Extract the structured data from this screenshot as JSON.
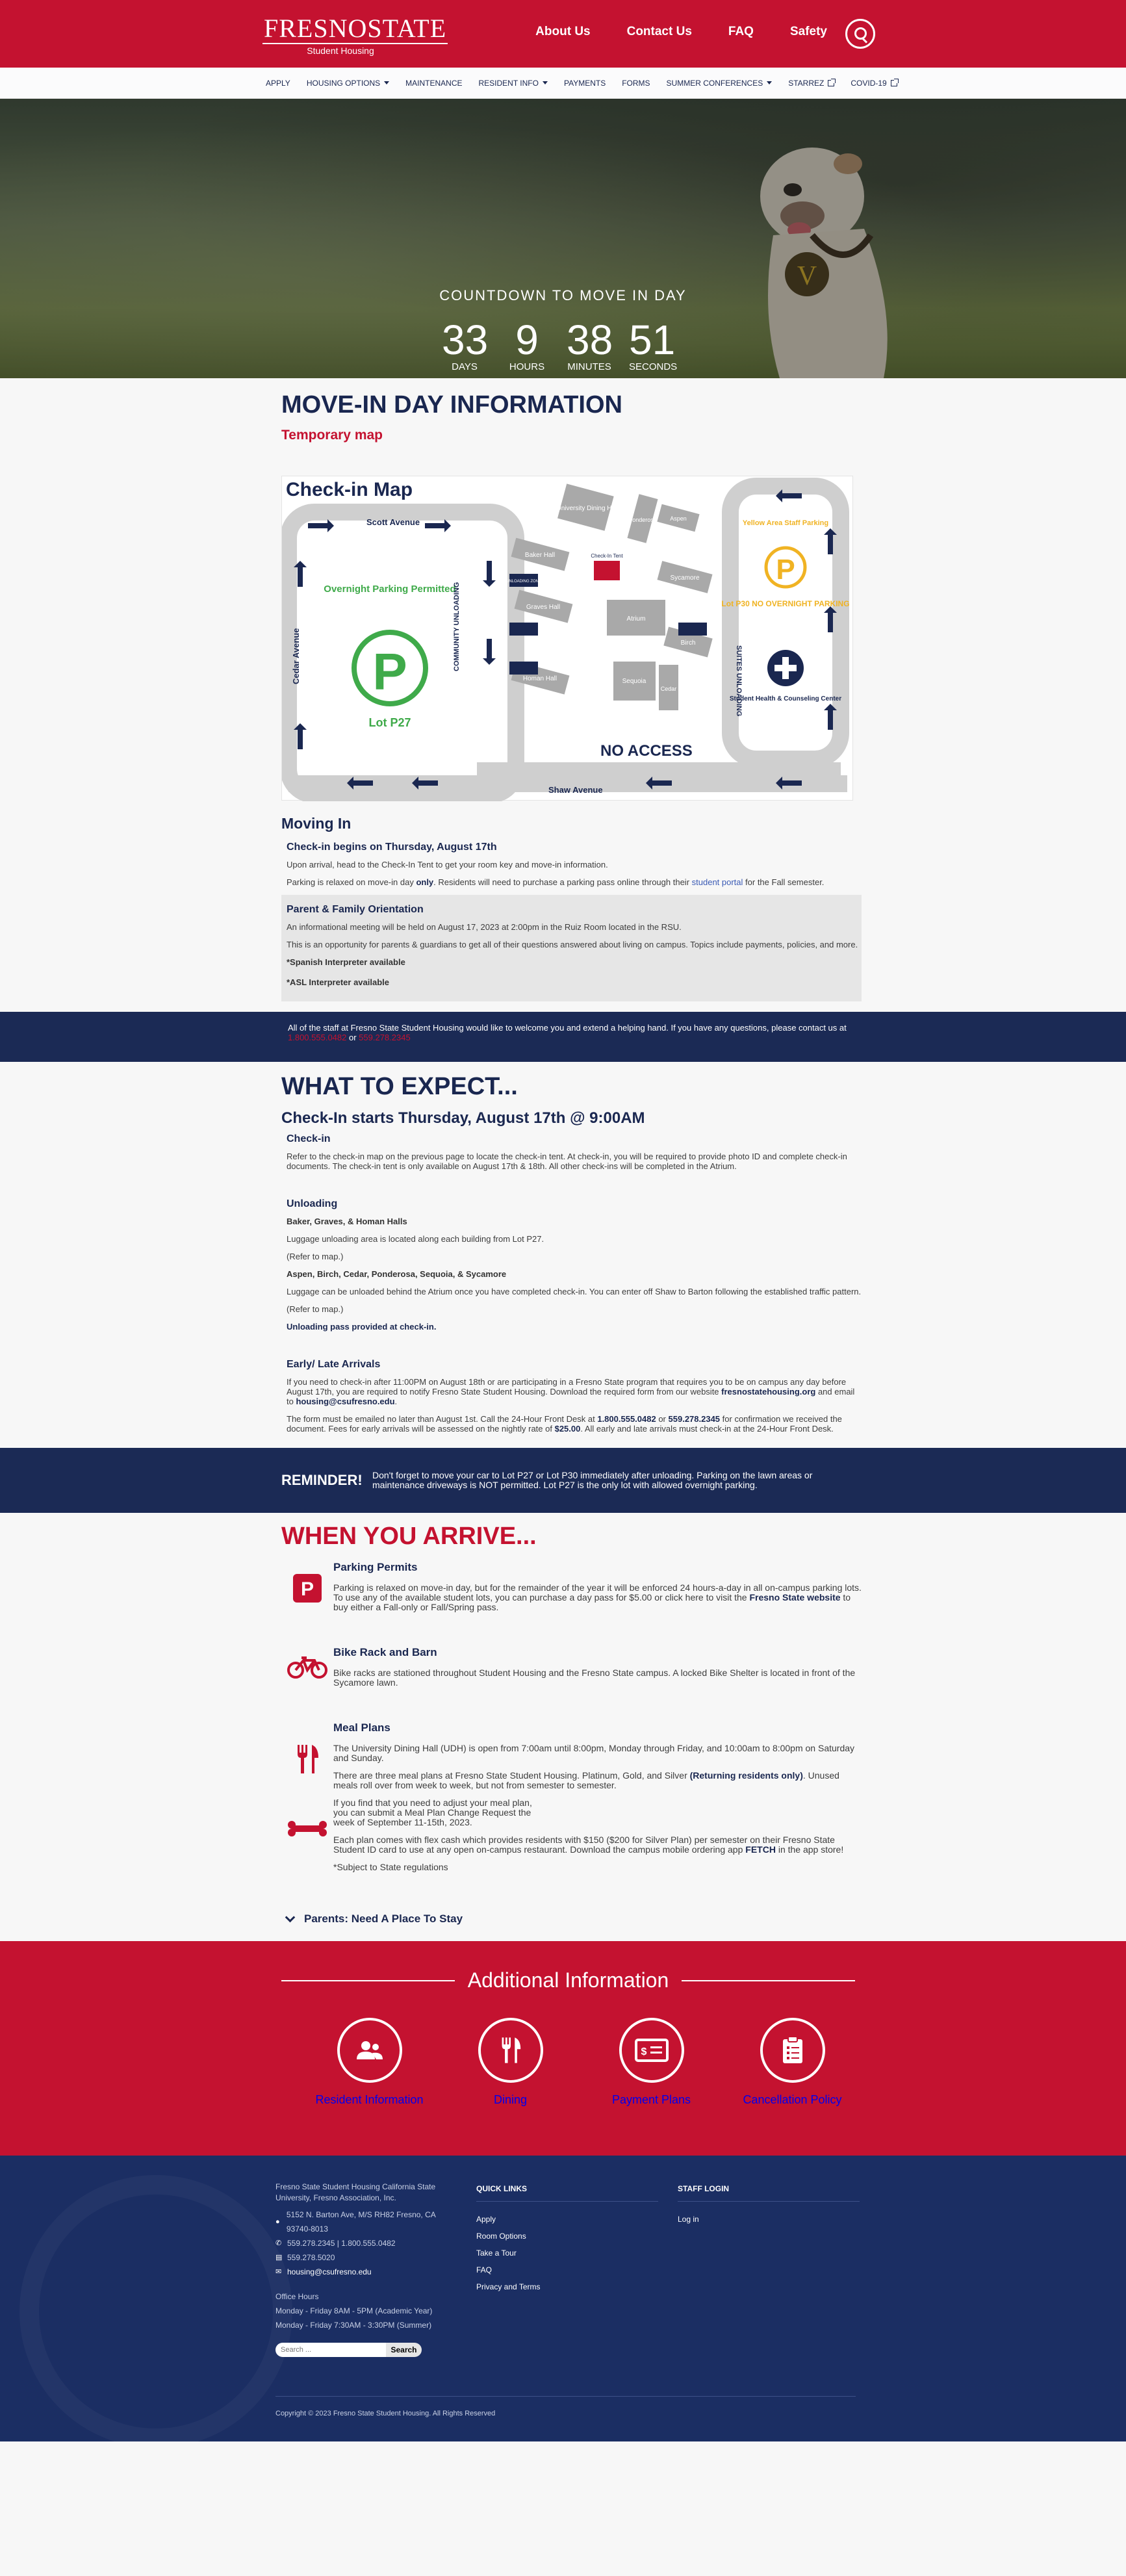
{
  "header": {
    "brand": "FRESNOSTATE",
    "sub_brand": "Student Housing",
    "nav": [
      "About Us",
      "Contact Us",
      "FAQ",
      "Safety"
    ]
  },
  "subnav": [
    {
      "label": "APPLY"
    },
    {
      "label": "HOUSING OPTIONS"
    },
    {
      "label": "MAINTENANCE"
    },
    {
      "label": "RESIDENT INFO"
    },
    {
      "label": "PAYMENTS"
    },
    {
      "label": "FORMS"
    },
    {
      "label": "SUMMER CONFERENCES"
    },
    {
      "label": "STARREZ"
    },
    {
      "label": "COVID-19"
    }
  ],
  "hero": {
    "title": "COUNTDOWN TO MOVE IN DAY",
    "days": "33",
    "days_label": "DAYS",
    "hours": "9",
    "hours_label": "HOURS",
    "minutes": "38",
    "minutes_label": "MINUTES",
    "seconds": "51",
    "seconds_label": "SECONDS"
  },
  "movein": {
    "title": "MOVE-IN DAY INFORMATION",
    "map_link": "Temporary map",
    "map": {
      "title": "Check-in Map",
      "scott": "Scott Avenue",
      "shaw": "Shaw Avenue",
      "cedar": "Cedar Avenue",
      "overnight": "Overnight Parking Permitted",
      "p27": "Lot P27",
      "community": "COMMUNITY UNLOADING",
      "suites": "SUITES UNLOADING",
      "yellow": "Yellow Area Staff Parking",
      "p30": "Lot P30 NO OVERNIGHT PARKING",
      "health": "Student Health & Counseling Center",
      "no_access": "NO ACCESS",
      "buildings": [
        "University Dining Hall",
        "Ponderosa",
        "Aspen",
        "Baker Hall",
        "Check-In Tent",
        "Sycamore",
        "Graves Hall",
        "Atrium",
        "Birch",
        "Homan Hall",
        "Sequoia",
        "Cedar"
      ],
      "unloading_zone": "UNLOADING ZONE"
    },
    "moving_in": "Moving In",
    "checkin_begins": "Check-in begins on Thursday, August 17th",
    "p1": "Upon arrival, head to the Check-In Tent to get your room key and move-in information.",
    "p2_a": "Parking is relaxed on move-in day ",
    "p2_b": "only",
    "p2_c": ". Residents will need to purchase a parking pass online through their ",
    "p2_link": "student portal",
    "p2_d": " for the Fall semester.",
    "orientation_title": "Parent & Family Orientation",
    "orientation_p1": "An informational meeting will be held on August 17, 2023 at 2:00pm in the Ruiz Room located in the RSU.",
    "orientation_p2": "This is an opportunity for parents & guardians to get all of their questions answered about living on campus. Topics include payments, policies, and more.",
    "spanish": "*Spanish Interpreter available",
    "asl": "*ASL Interpreter available"
  },
  "welcome": {
    "text": "All of the staff at Fresno State Student Housing would like to welcome you and extend a helping hand. If you have any questions, please contact us at ",
    "phone1": "1.800.555.0482",
    "or": " or ",
    "phone2": "559.278.2345"
  },
  "expect": {
    "title": "WHAT TO EXPECT...",
    "subtitle": "Check-In starts Thursday, August 17th @ 9:00AM",
    "checkin_h": "Check-in",
    "checkin_p": "Refer to the check-in map on the previous page to locate the check-in tent. At check-in, you will be required to provide photo ID and complete check-in documents. The check-in tent is only available on August 17th & 18th. All other check-ins will be completed in the Atrium.",
    "unloading_h": "Unloading",
    "bgh": "Baker, Graves, & Homan Halls",
    "bgh_p": "Luggage unloading area is located along each building from Lot P27.",
    "refer": "(Refer to map.)",
    "abc": "Aspen, Birch, Cedar, Ponderosa, Sequoia, & Sycamore",
    "abc_p": "Luggage can be unloaded behind the Atrium once you have completed check-in. You can enter off Shaw to Barton following the established traffic pattern.",
    "refer2": "(Refer to map.)",
    "pass": "Unloading pass provided at check-in.",
    "early_h": "Early/ Late Arrivals",
    "early_p1_a": "If you need to check-in after 11:00PM on August 18th or are participating in a Fresno State program that requires you to be on campus any day before August 17th, you are required to notify Fresno State Student Housing. Download the required form from our website ",
    "early_p1_link": "fresnostatehousing.org",
    "early_p1_b": " and email to ",
    "early_p1_email": "housing@csufresno.edu",
    "early_p1_c": ".",
    "early_p2_a": "The form must be emailed no later than August 1st. Call the 24-Hour Front Desk at ",
    "early_p2_ph1": "1.800.555.0482",
    "early_p2_or": " or ",
    "early_p2_ph2": "559.278.2345",
    "early_p2_b": " for confirmation we received the document. Fees for early arrivals will be assessed on the nightly rate of ",
    "early_p2_fee": "$25.00",
    "early_p2_c": ". All early and late arrivals must check-in at the 24-Hour Front Desk."
  },
  "reminder": {
    "tag": "REMINDER!",
    "text": "Don't forget to move your car to Lot P27 or Lot P30 immediately after unloading. Parking on the lawn areas or maintenance driveways is NOT permitted. Lot P27 is the only lot with allowed overnight parking."
  },
  "arrive": {
    "title": "WHEN YOU ARRIVE...",
    "parking_h": "Parking Permits",
    "parking_p_a": "Parking is relaxed on move-in day, but for the remainder of the year it will be enforced 24 hours-a-day in all on-campus parking lots. To use any of the available student lots, you can purchase a day pass for $5.00 or click here to visit the ",
    "parking_link": "Fresno State website",
    "parking_p_b": " to buy either a Fall-only or Fall/Spring pass.",
    "bike_h": "Bike Rack and Barn",
    "bike_p": "Bike racks are stationed throughout Student Housing and the Fresno State campus. A locked Bike Shelter is located in front of the Sycamore lawn.",
    "meal_h": "Meal Plans",
    "meal_p1": "The University Dining Hall (UDH) is open from 7:00am until 8:00pm, Monday through Friday, and 10:00am to 8:00pm on Saturday and Sunday.",
    "meal_p2_a": "There are three meal plans at Fresno State Student Housing. Platinum, Gold, and Silver ",
    "meal_p2_b": "(Returning residents only)",
    "meal_p2_c": ". Unused meals roll over from week to week, but not from semester to semester.",
    "meal_p3": "If you find that you need to adjust your meal plan, you can submit a Meal Plan Change Request the week of September 11-15th, 2023.",
    "meal_p4_a": "Each plan comes with flex cash which provides residents with $150 ($200 for Silver Plan) per semester on their Fresno State Student ID card to use at any open on-campus restaurant. Download the campus mobile ordering app ",
    "meal_p4_b": "FETCH",
    "meal_p4_c": " in the app store!",
    "meal_p5": "*Subject to State regulations",
    "accordion": "Parents: Need A Place To Stay"
  },
  "additional": {
    "title": "Additional Information",
    "cards": [
      "Resident Information",
      "Dining",
      "Payment Plans",
      "Cancellation Policy"
    ]
  },
  "footer": {
    "org": "Fresno State Student Housing California State University, Fresno Association, Inc.",
    "address": "5152 N. Barton Ave, M/S RH82 Fresno, CA 93740-8013",
    "phones": "559.278.2345  |  1.800.555.0482",
    "fax": "559.278.5020",
    "email": "housing@csufresno.edu",
    "office_hours": "Office Hours",
    "hours1": "Monday - Friday 8AM - 5PM (Academic Year)",
    "hours2": "Monday - Friday 7:30AM - 3:30PM (Summer)",
    "search_placeholder": "Search ...",
    "search_button": "Search",
    "quick_links_title": "QUICK LINKS",
    "quick_links": [
      "Apply",
      "Room Options",
      "Take a Tour",
      "FAQ",
      "Privacy and Terms"
    ],
    "staff_title": "STAFF LOGIN",
    "staff_links": [
      "Log in"
    ],
    "copyright": "Copyright © 2023 Fresno State Student Housing. All Rights Reserved"
  }
}
